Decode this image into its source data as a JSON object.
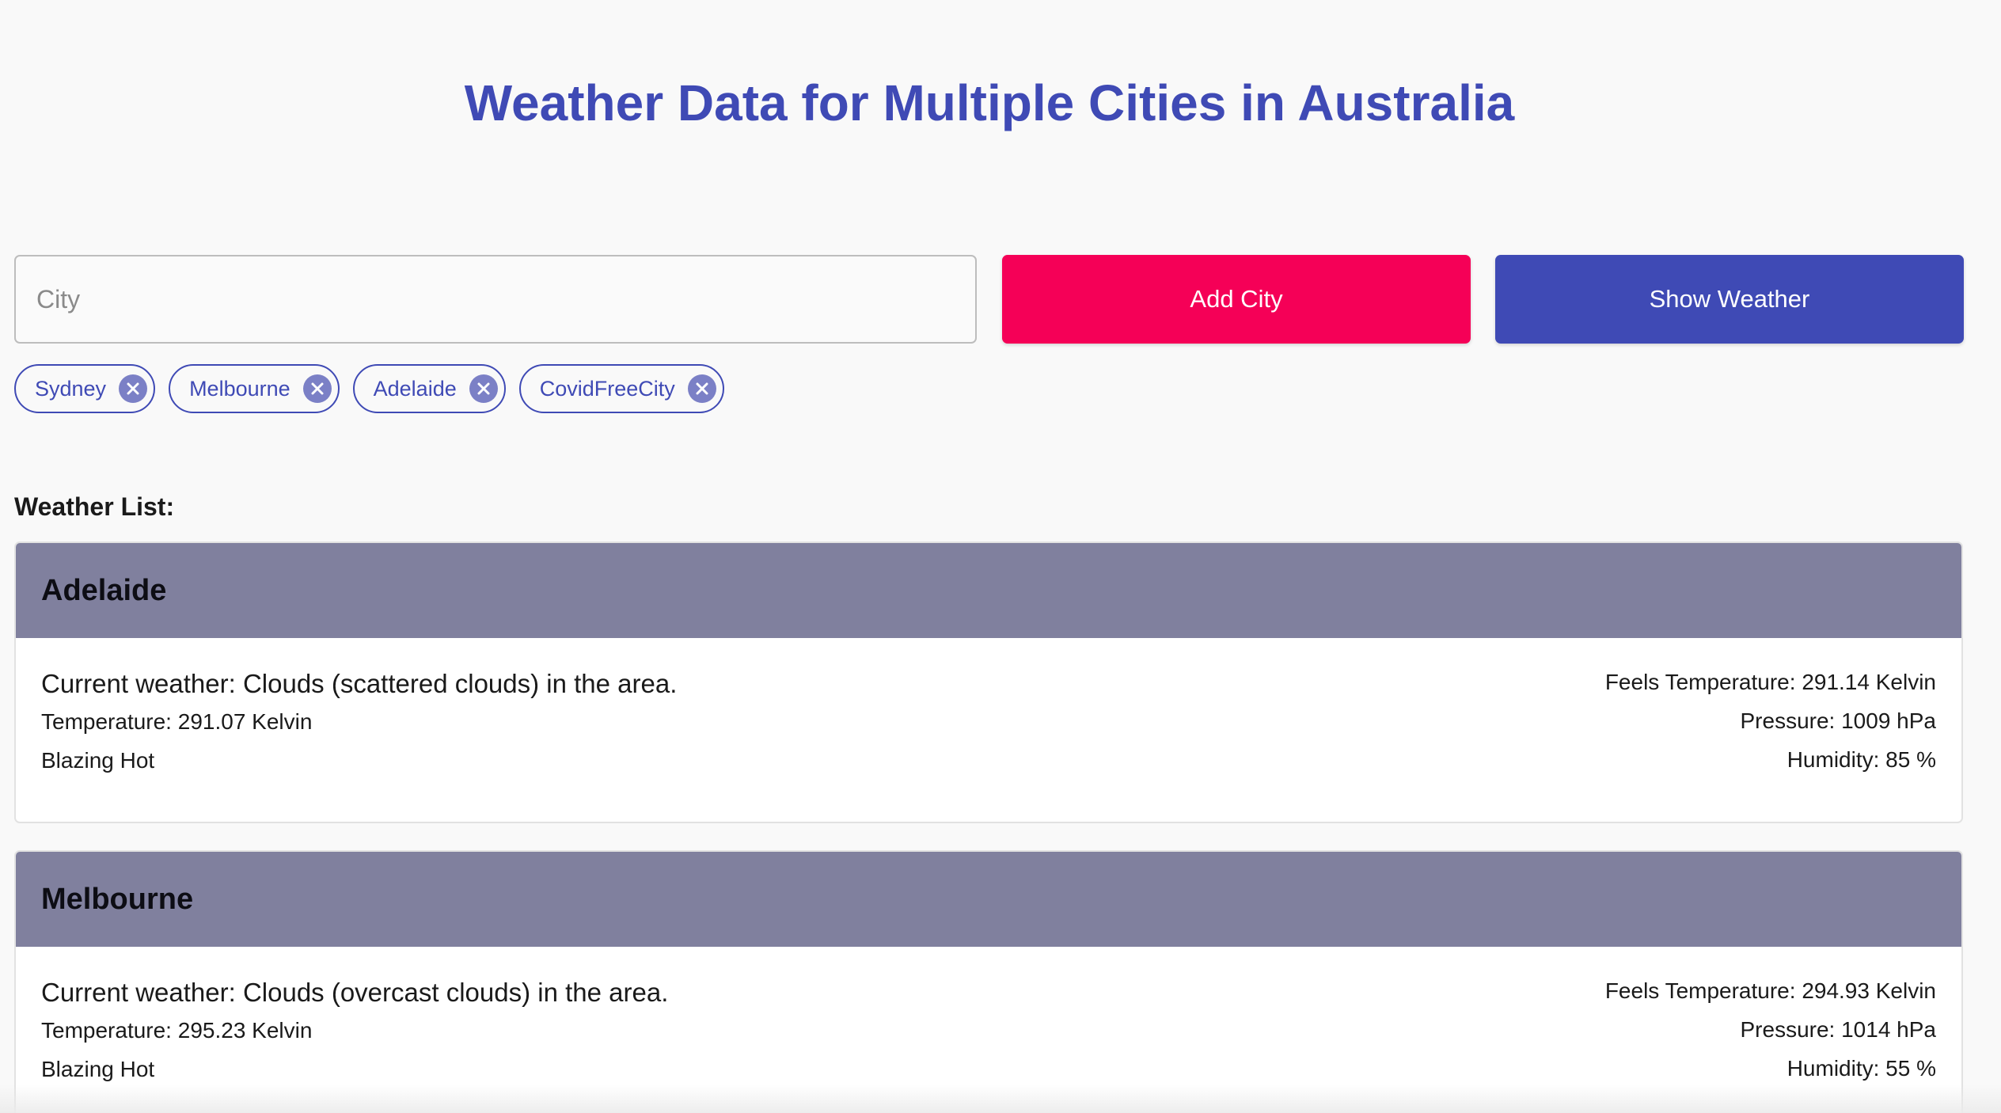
{
  "page": {
    "title": "Weather Data for Multiple Cities in Australia"
  },
  "controls": {
    "city_placeholder": "City",
    "city_value": "",
    "add_button_label": "Add City",
    "show_button_label": "Show Weather"
  },
  "chips": [
    {
      "label": "Sydney"
    },
    {
      "label": "Melbourne"
    },
    {
      "label": "Adelaide"
    },
    {
      "label": "CovidFreeCity"
    }
  ],
  "weather_list": {
    "label": "Weather List:",
    "items": [
      {
        "city": "Adelaide",
        "current": "Current weather: Clouds (scattered clouds) in the area.",
        "temperature": "Temperature: 291.07 Kelvin",
        "remark": "Blazing Hot",
        "feels": "Feels Temperature: 291.14 Kelvin",
        "pressure": "Pressure: 1009 hPa",
        "humidity": "Humidity: 85 %"
      },
      {
        "city": "Melbourne",
        "current": "Current weather: Clouds (overcast clouds) in the area.",
        "temperature": "Temperature: 295.23 Kelvin",
        "remark": "Blazing Hot",
        "feels": "Feels Temperature: 294.93 Kelvin",
        "pressure": "Pressure: 1014 hPa",
        "humidity": "Humidity: 55 %"
      }
    ]
  },
  "icons": {
    "chip_remove": "close-circle-icon"
  },
  "colors": {
    "primary": "#3f4ab5",
    "accent": "#f50057",
    "card_header": "#80809e"
  }
}
